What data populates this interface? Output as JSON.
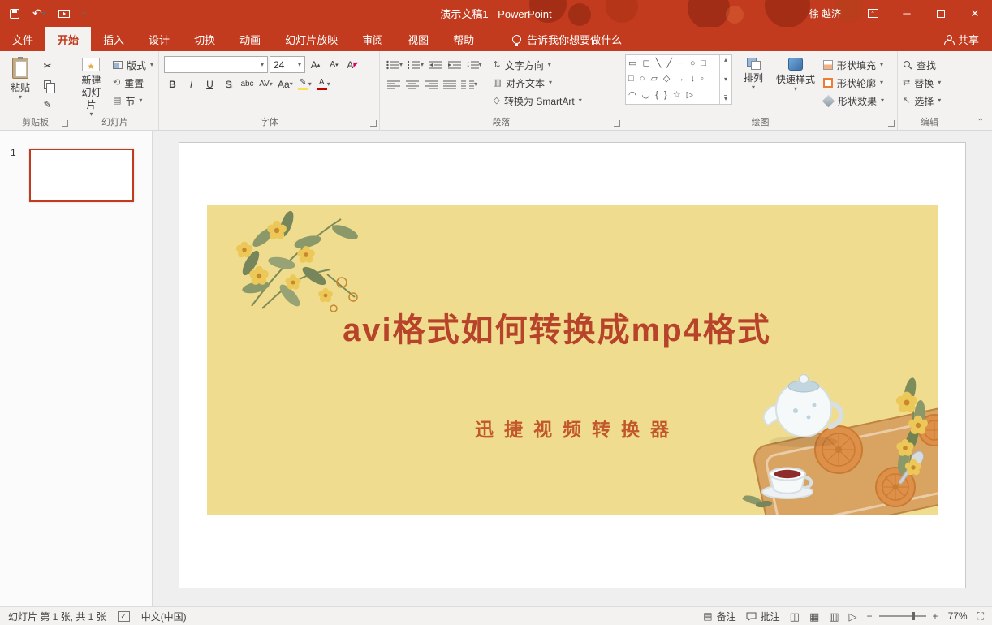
{
  "titlebar": {
    "title": "演示文稿1  -  PowerPoint",
    "user": "徐 越济"
  },
  "tabs": [
    "文件",
    "开始",
    "插入",
    "设计",
    "切换",
    "动画",
    "幻灯片放映",
    "审阅",
    "视图",
    "帮助"
  ],
  "tellme": "告诉我你想要做什么",
  "share_label": "共享",
  "ribbon": {
    "clipboard": {
      "group_label": "剪贴板",
      "paste": "粘贴"
    },
    "slides": {
      "group_label": "幻灯片",
      "new_slide": "新建幻灯片",
      "layout": "版式",
      "reset": "重置",
      "section": "节"
    },
    "font": {
      "group_label": "字体",
      "font_size": "24",
      "bold": "B",
      "italic": "I",
      "underline": "U",
      "shadow": "S",
      "strike": "abc",
      "spacing": "AV",
      "case": "Aa",
      "grow": "A",
      "shrink": "A",
      "clear": "A"
    },
    "paragraph": {
      "group_label": "段落",
      "text_direction": "文字方向",
      "align_text": "对齐文本",
      "smartart": "转换为 SmartArt"
    },
    "drawing": {
      "group_label": "绘图",
      "arrange": "排列",
      "quick_styles": "快速样式",
      "shape_fill": "形状填充",
      "shape_outline": "形状轮廓",
      "shape_effects": "形状效果"
    },
    "editing": {
      "group_label": "编辑",
      "find": "查找",
      "replace": "替换",
      "select": "选择"
    }
  },
  "slides_panel": {
    "slide_number": "1"
  },
  "slide": {
    "title": "avi格式如何转换成mp4格式",
    "subtitle": "迅捷视频转换器"
  },
  "statusbar": {
    "slide_info": "幻灯片 第 1 张, 共 1 张",
    "language": "中文(中国)",
    "notes": "备注",
    "comments": "批注",
    "zoom_level": "77%"
  }
}
